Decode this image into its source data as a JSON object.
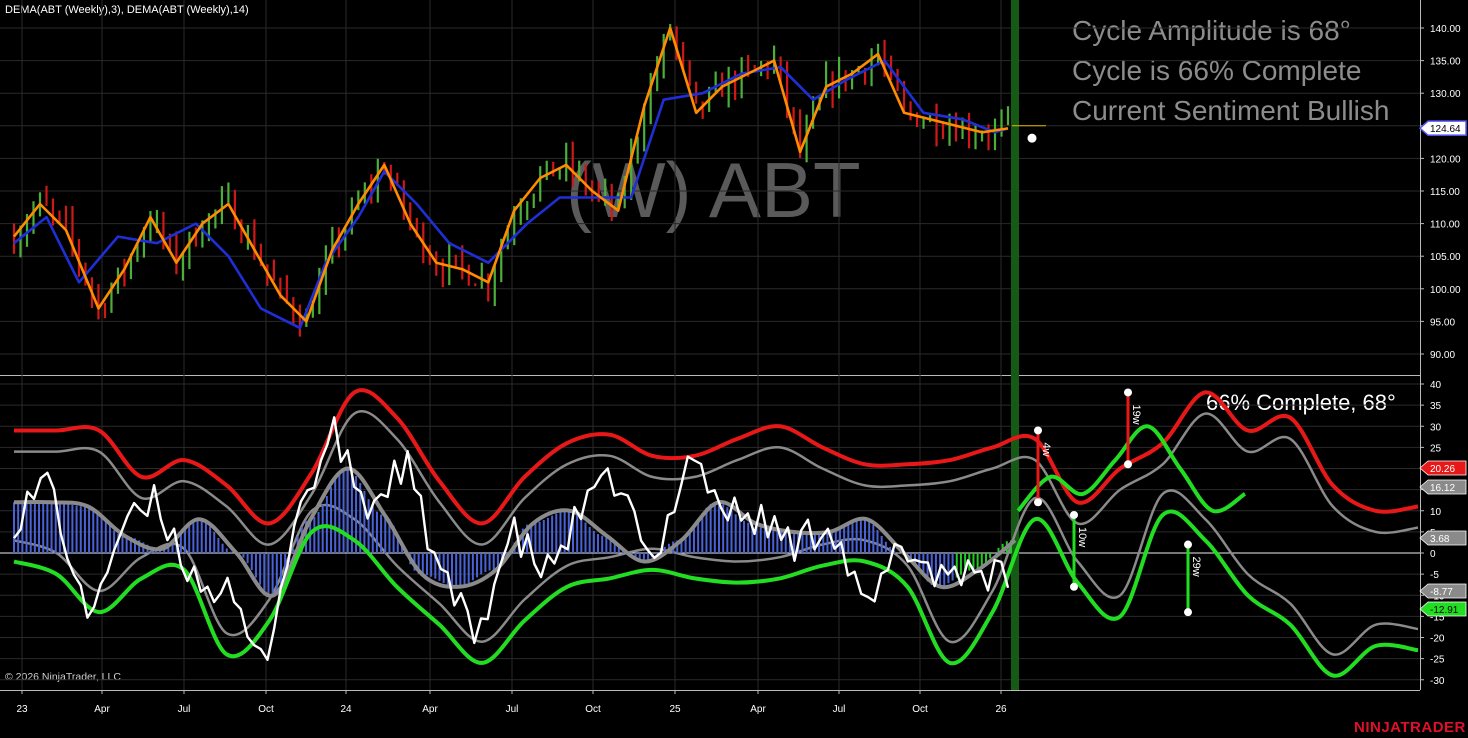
{
  "header": {
    "indicator_label": "DEMA(ABT (Weekly),3), DEMA(ABT (Weekly),14)",
    "watermark": "(W) ABT"
  },
  "info_panel": {
    "line1": "Cycle Amplitude is 68°",
    "line2": "Cycle is 66% Complete",
    "line3": "Current Sentiment Bullish"
  },
  "footer": {
    "copyright": "© 2026 NinjaTrader, LLC",
    "brand": "NINJATRADER"
  },
  "colors": {
    "background": "#000000",
    "up_bar": "#4caf3a",
    "down_bar": "#d01818",
    "dema_fast": "#ff8c00",
    "dema_slow": "#1f2fd6",
    "upper_band": "#e81818",
    "lower_band": "#22dd22",
    "mid_band": "#8a8a8a",
    "oscillator": "#ffffff",
    "histogram_pos": "#4a62d8",
    "histogram_neg": "#4a62d8",
    "histogram_recent": "#22cc22",
    "current_bar_marker": "#155a15",
    "grid": "#2a2a2a"
  },
  "chart_data": [
    {
      "type": "bar",
      "title": "",
      "ylim": [
        88,
        143
      ],
      "y_ticks": [
        "90.00",
        "95.00",
        "100.00",
        "105.00",
        "110.00",
        "115.00",
        "120.00",
        "125.00",
        "130.00",
        "135.00",
        "140.00"
      ],
      "last_price_label": "124.64",
      "series": [
        {
          "name": "DEMA(ABT (Weekly),3)",
          "x": [
            0,
            4,
            8,
            13,
            17,
            21,
            25,
            29,
            33,
            37,
            41,
            45,
            49,
            53,
            57,
            61,
            65,
            69,
            73,
            77,
            81,
            85,
            89,
            93,
            97,
            101,
            105,
            109,
            113,
            117,
            121,
            125,
            129,
            133,
            137,
            141,
            145,
            149,
            153
          ],
          "values": [
            108,
            113,
            109,
            97,
            103,
            111,
            104,
            110,
            113,
            106,
            99,
            95,
            106,
            113,
            119,
            110,
            104,
            103,
            101,
            112,
            117,
            119,
            115,
            112,
            128,
            140,
            127,
            131,
            133,
            135,
            121,
            131,
            133,
            136,
            127,
            126,
            125,
            124,
            124.6
          ]
        },
        {
          "name": "DEMA(ABT (Weekly),14)",
          "x": [
            0,
            5,
            10,
            16,
            22,
            28,
            33,
            38,
            44,
            48,
            53,
            57,
            62,
            67,
            73,
            79,
            84,
            90,
            95,
            100,
            106,
            112,
            118,
            123,
            128,
            134,
            140,
            146,
            151,
            153
          ],
          "values": [
            107,
            111,
            101,
            108,
            107,
            110,
            105,
            97,
            94,
            104,
            111,
            118,
            113,
            107,
            104,
            110,
            114,
            114,
            114,
            129,
            130,
            133,
            134,
            129,
            132,
            135,
            127,
            126,
            124,
            124.6
          ]
        }
      ]
    },
    {
      "type": "line",
      "title": "",
      "status_label": "66% Complete, 68°",
      "ylim": [
        -31,
        41
      ],
      "y_ticks": [
        "40",
        "35",
        "30",
        "25",
        "20",
        "15",
        "10",
        "5",
        "0",
        "-5",
        "-10",
        "-15",
        "-20",
        "-25",
        "-30"
      ],
      "x_ticks": [
        "23",
        "Apr",
        "Jul",
        "Oct",
        "24",
        "Apr",
        "Jul",
        "Oct",
        "25",
        "Apr",
        "Jul",
        "Oct",
        "26"
      ],
      "value_labels": [
        {
          "text": "20.26",
          "color": "#e81818"
        },
        {
          "text": "16.12",
          "color": "#8a8a8a"
        },
        {
          "text": "3.68",
          "color": "#8a8a8a"
        },
        {
          "text": "-8.77",
          "color": "#8a8a8a"
        },
        {
          "text": "-12.91",
          "color": "#22dd22"
        }
      ],
      "cycle_markers": [
        {
          "label": "4w"
        },
        {
          "label": "19w"
        },
        {
          "label": "10w"
        },
        {
          "label": "29w"
        }
      ],
      "series": [
        {
          "name": "Upper Band",
          "values": [
            29,
            29,
            29,
            18,
            22,
            16,
            7,
            19,
            38,
            32,
            17,
            7,
            18,
            26,
            28,
            23,
            23,
            27,
            30,
            25,
            21,
            21,
            22,
            25,
            27,
            12,
            20,
            26,
            38,
            29,
            32,
            16,
            10,
            11
          ]
        },
        {
          "name": "Lower Band",
          "values": [
            -2,
            -5,
            -14,
            -6,
            -4,
            -24,
            -16,
            5,
            3,
            -8,
            -17,
            -26,
            -16,
            -8,
            -6,
            -4,
            -6,
            -7,
            -6,
            -3,
            -2,
            -8,
            -26,
            -14,
            8,
            -7,
            -15,
            9,
            3,
            -10,
            -17,
            -29,
            -22,
            -23
          ]
        },
        {
          "name": "Oscillator",
          "values": [
            8,
            18,
            -16,
            5,
            12,
            -5,
            -10,
            -27,
            10,
            28,
            10,
            22,
            -5,
            -20,
            5,
            -5,
            10,
            18,
            -5,
            25,
            10,
            8,
            2,
            8,
            -15,
            2,
            -5,
            -3,
            -7
          ]
        },
        {
          "name": "Cycle Histogram",
          "values": [
            12,
            12,
            11,
            4,
            1,
            8,
            0,
            -10,
            8,
            20,
            9,
            -5,
            -8,
            -4,
            7,
            10,
            4,
            -2,
            3,
            12,
            7,
            5,
            5,
            8,
            0,
            -8,
            -4,
            3
          ]
        }
      ]
    }
  ]
}
